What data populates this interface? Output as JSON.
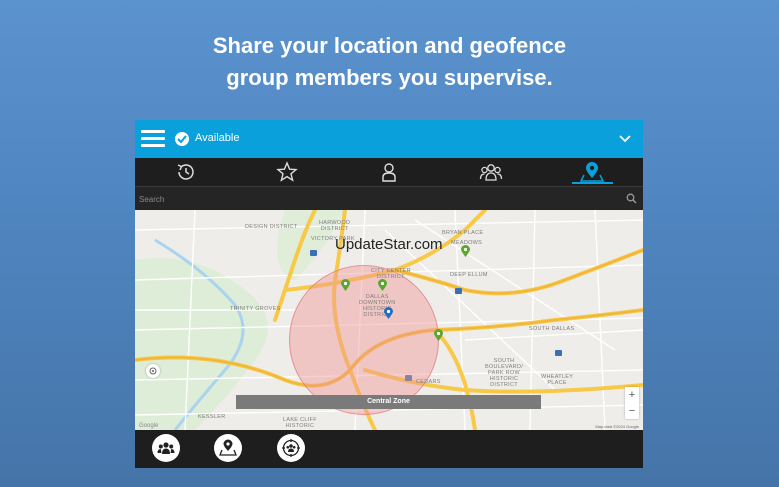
{
  "headline": {
    "line1": "Share your location and geofence",
    "line2": "group members you supervise."
  },
  "status": {
    "label": "Available",
    "icons": [
      "menu-icon",
      "check-circle-icon",
      "chevron-down-icon"
    ]
  },
  "tabs": [
    {
      "name": "history",
      "icon": "history-icon",
      "active": false
    },
    {
      "name": "favorites",
      "icon": "star-icon",
      "active": false
    },
    {
      "name": "contacts",
      "icon": "person-icon",
      "active": false
    },
    {
      "name": "groups",
      "icon": "group-icon",
      "active": false
    },
    {
      "name": "locations",
      "icon": "location-pin-icon",
      "active": true
    }
  ],
  "search": {
    "placeholder": "Search"
  },
  "map": {
    "watermark": "UpdateStar.com",
    "zone_label": "Central Zone",
    "labels": {
      "design_district": "DESIGN DISTRICT",
      "harwood_district": "HARWOOD\nDISTRICT",
      "victory_park": "VICTORY PARK",
      "bryan_place": "BRYAN PLACE",
      "meadows": "MEADOWS",
      "city_center": "CITY CENTER\nDISTRICT",
      "deep_ellum": "DEEP ELLUM",
      "dallas_downtown": "DALLAS\nDOWNTOWN\nHISTORIC\nDISTRICT",
      "trinity_groves": "TRINITY GROVES",
      "south_dallas": "SOUTH DALLAS",
      "south_boulevard": "SOUTH\nBOULEVARD/\nPARK ROW\nHISTORIC\nDISTRICT",
      "wheatley_place": "WHEATLEY\nPLACE",
      "cedars": "CEDARS",
      "kessler": "KESSLER",
      "lake_cliff": "LAKE CLIFF\nHISTORIC"
    },
    "credit": "Map data ©2024 Google",
    "google": "Google",
    "zoom_in": "+",
    "zoom_out": "−",
    "accent_color": "#0aa0dc",
    "geofence_color": "#f09696"
  },
  "bottom_actions": [
    {
      "name": "group-members",
      "icon": "group-icon"
    },
    {
      "name": "map-location",
      "icon": "map-pin-icon"
    },
    {
      "name": "geofence-members",
      "icon": "geofence-group-icon"
    }
  ]
}
